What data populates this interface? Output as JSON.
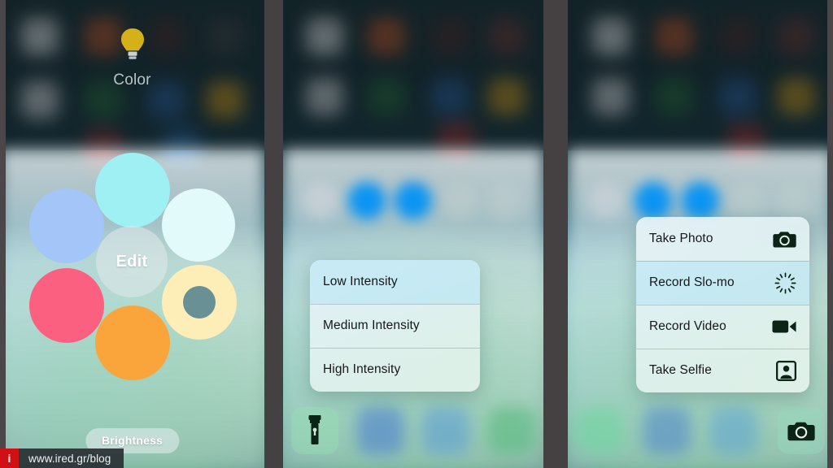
{
  "watermark": {
    "badge": "i",
    "url": "www.ired.gr/blog"
  },
  "panels": [
    {
      "id": "color-picker",
      "header": {
        "icon": "light-bulb-icon",
        "label": "Color",
        "bulb_color": "#d4b118"
      },
      "edit_label": "Edit",
      "footer_label": "Brightness",
      "swatches": [
        {
          "name": "swatch-cyan",
          "color": "#9ff0f3",
          "selected": false
        },
        {
          "name": "swatch-blue",
          "color": "#a4c5f7",
          "selected": false
        },
        {
          "name": "swatch-pale-cyan",
          "color": "#e2fafa",
          "selected": false
        },
        {
          "name": "swatch-pink",
          "color": "#fb6081",
          "selected": false
        },
        {
          "name": "swatch-cream",
          "color": "#fceeb6",
          "selected": true
        },
        {
          "name": "swatch-orange",
          "color": "#f9a53c",
          "selected": false
        }
      ]
    },
    {
      "id": "flashlight-actions",
      "shortcut_icon": "flashlight-icon",
      "menu": [
        {
          "label": "Low Intensity",
          "icon": "",
          "highlighted": true
        },
        {
          "label": "Medium Intensity",
          "icon": "",
          "highlighted": false
        },
        {
          "label": "High Intensity",
          "icon": "",
          "highlighted": false
        }
      ]
    },
    {
      "id": "camera-actions",
      "shortcut_icon": "camera-icon",
      "menu": [
        {
          "label": "Take Photo",
          "icon": "camera-icon",
          "highlighted": false
        },
        {
          "label": "Record Slo-mo",
          "icon": "slo-mo-icon",
          "highlighted": true
        },
        {
          "label": "Record Video",
          "icon": "video-camera-icon",
          "highlighted": false
        },
        {
          "label": "Take Selfie",
          "icon": "selfie-icon",
          "highlighted": false
        }
      ]
    }
  ],
  "colors": {
    "divider": "#454142",
    "menu_highlight": "#96dcf5",
    "icon_dark": "#0c2415",
    "watermark_badge": "#cf1014"
  }
}
